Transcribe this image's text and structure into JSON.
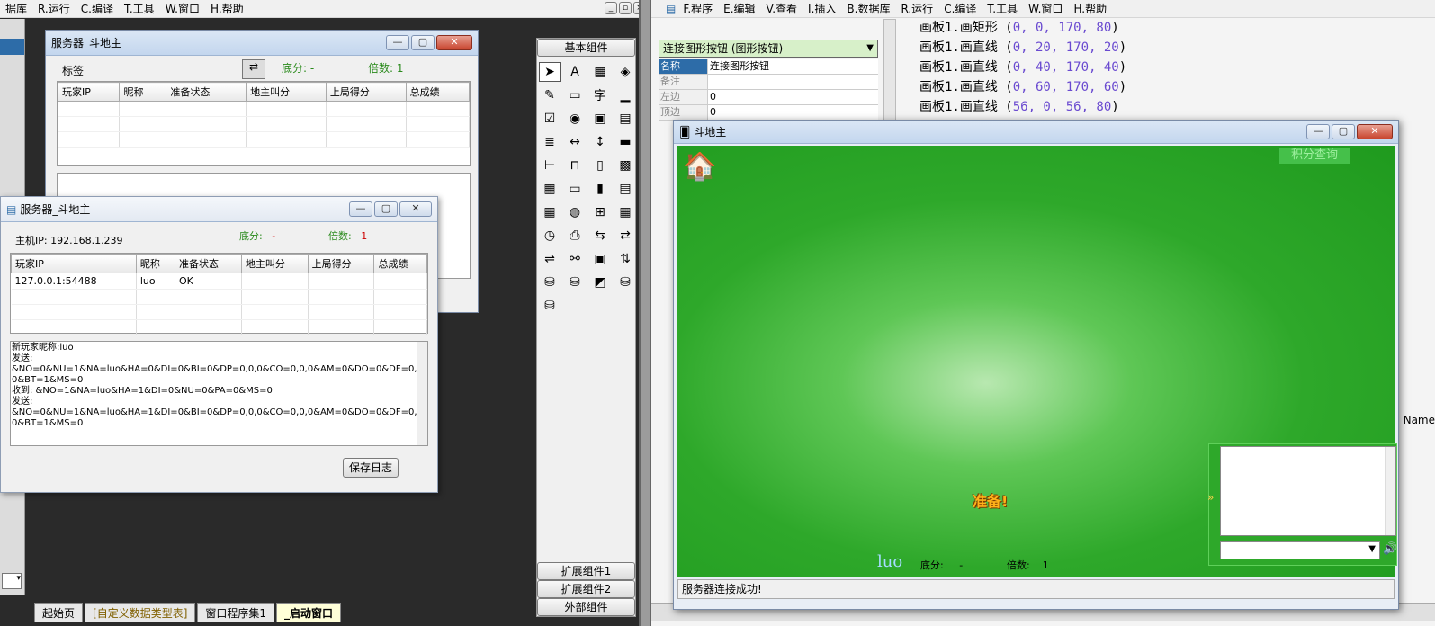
{
  "ide_left": {
    "menu": [
      "据库",
      "R.运行",
      "C.编译",
      "T.工具",
      "W.窗口",
      "H.帮助"
    ],
    "bottom_tabs": [
      "起始页",
      "[自定义数据类型表]",
      "窗口程序集1",
      "_启动窗口"
    ]
  },
  "designer": {
    "title": "服务器_斗地主",
    "label": "标签",
    "base_score_label": "底分: -",
    "multiplier_label": "倍数: 1",
    "columns": [
      "玩家IP",
      "昵称",
      "准备状态",
      "地主叫分",
      "上局得分",
      "总成绩"
    ]
  },
  "server": {
    "title": "服务器_斗地主",
    "host_ip": "主机IP: 192.168.1.239",
    "base_score_label": "底分:",
    "base_score_value": "-",
    "multiplier_label": "倍数:",
    "multiplier_value": "1",
    "columns": [
      "玩家IP",
      "昵称",
      "准备状态",
      "地主叫分",
      "上局得分",
      "总成绩"
    ],
    "rows": [
      [
        "127.0.0.1:54488",
        "luo",
        "OK",
        "",
        "",
        ""
      ]
    ],
    "log_lines": [
      "新玩家昵称:luo",
      "发送:",
      "&NO=0&NU=1&NA=luo&HA=0&DI=0&BI=0&DP=0,0,0&CO=0,0,0&AM=0&DO=0&DF=0,0,0,0,0,",
      "0&BT=1&MS=0",
      "收到: &NO=1&NA=luo&HA=1&DI=0&NU=0&PA=0&MS=0",
      "发送:",
      "&NO=0&NU=1&NA=luo&HA=1&DI=0&BI=0&DP=0,0,0&CO=0,0,0&AM=0&DO=0&DF=0,0,0,0,0,",
      "0&BT=1&MS=0"
    ],
    "save_log": "保存日志"
  },
  "toolbox": {
    "header": "基本组件",
    "icons": [
      "pointer-icon",
      "text-icon",
      "picture-icon",
      "shape-icon",
      "edit-icon",
      "button-icon",
      "label-icon",
      "frame-icon",
      "checkbox-icon",
      "radio-icon",
      "panel-icon",
      "listbox-icon",
      "list-icon",
      "hscroll-icon",
      "vscroll-icon",
      "progress-icon",
      "ruler-icon",
      "tab-icon",
      "file-icon",
      "image-icon",
      "grid-icon",
      "combo-icon",
      "dbf-icon",
      "doc-icon",
      "table-icon",
      "globe-icon",
      "tree-icon",
      "calendar-icon",
      "clock-icon",
      "printer-icon",
      "server-icon",
      "client-icon",
      "net-icon",
      "link-icon",
      "window-icon",
      "connect-icon",
      "db-icon",
      "db2-icon",
      "chart-icon",
      "odbc-icon",
      "odbc2-icon"
    ],
    "footer": [
      "扩展组件1",
      "扩展组件2",
      "外部组件"
    ]
  },
  "ide_right": {
    "menu": [
      "F.程序",
      "E.编辑",
      "V.查看",
      "I.插入",
      "B.数据库",
      "R.运行",
      "C.编译",
      "T.工具",
      "W.窗口",
      "H.帮助"
    ],
    "component_select": "连接图形按钮 (图形按钮)",
    "props": [
      [
        "名称",
        "连接图形按钮"
      ],
      [
        "备注",
        ""
      ],
      [
        "左边",
        "0"
      ],
      [
        "顶边",
        "0"
      ]
    ],
    "code_lines": [
      [
        "画板1.画矩形 (",
        "0, 0, 170, 80",
        ")"
      ],
      [
        "画板1.画直线 (",
        "0, 20, 170, 20",
        ")"
      ],
      [
        "画板1.画直线 (",
        "0, 40, 170, 40",
        ")"
      ],
      [
        "画板1.画直线 (",
        "0, 60, 170, 60",
        ")"
      ],
      [
        "画板1.画直线 (",
        "56, 0, 56, 80",
        ")"
      ]
    ],
    "side_label": "Name"
  },
  "game": {
    "title": "斗地主",
    "score_query": "积分查询",
    "ready": "准备!",
    "player_name": "luo",
    "base_score_label": "底分:",
    "base_score_value": "-",
    "multiplier_label": "倍数:",
    "multiplier_value": "1",
    "status": "服务器连接成功!"
  },
  "colors": {
    "green": "#2ea82a",
    "accent": "#2d6ca8"
  }
}
